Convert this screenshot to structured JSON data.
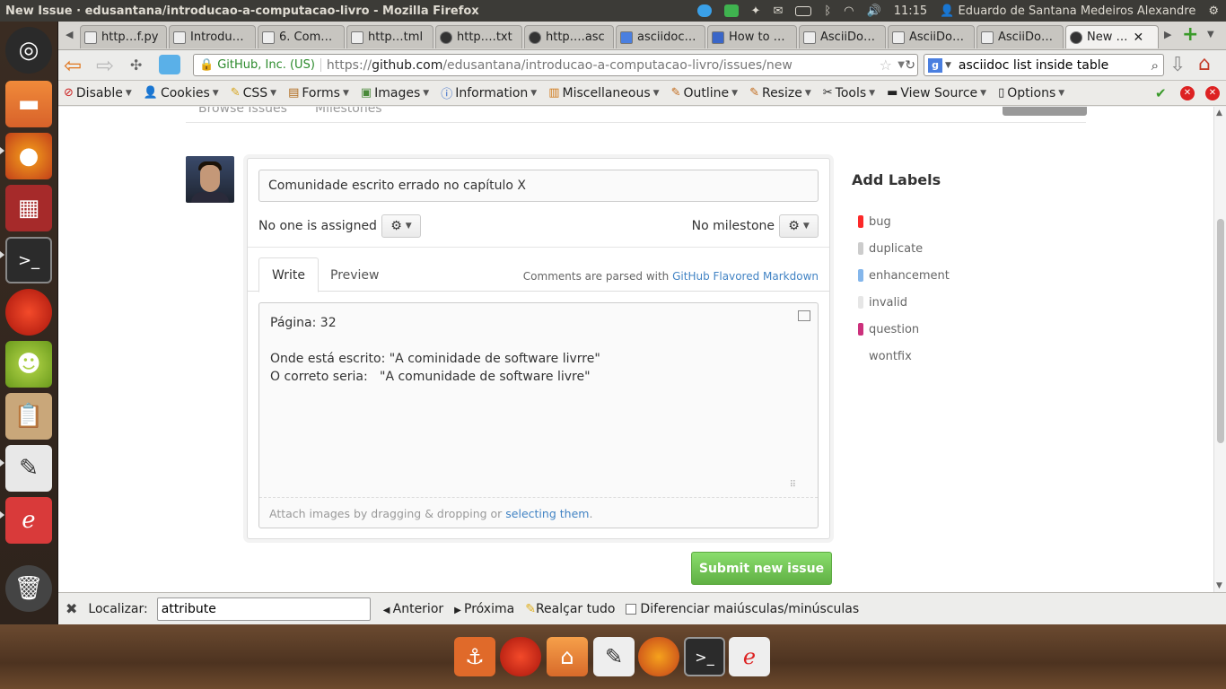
{
  "topbar": {
    "window_title": "New Issue · edusantana/introducao-a-computacao-livro - Mozilla Firefox",
    "time": "11:15",
    "user": "Eduardo de Santana Medeiros Alexandre"
  },
  "tabs": [
    {
      "label": "http…f.py"
    },
    {
      "label": "Introdu…"
    },
    {
      "label": "6. Com…"
    },
    {
      "label": "http…tml"
    },
    {
      "label": "http….txt"
    },
    {
      "label": "http….asc"
    },
    {
      "label": "asciidoc…"
    },
    {
      "label": "How to …"
    },
    {
      "label": "AsciiDo…"
    },
    {
      "label": "AsciiDo…"
    },
    {
      "label": "AsciiDo…"
    },
    {
      "label": "New …"
    }
  ],
  "navbar": {
    "identity": "GitHub, Inc. (US)",
    "url_prefix": "https://",
    "url_host": "github.com",
    "url_path": "/edusantana/introducao-a-computacao-livro/issues/new",
    "search_value": "asciidoc list inside table"
  },
  "devbar": {
    "items": [
      "Disable",
      "Cookies",
      "CSS",
      "Forms",
      "Images",
      "Information",
      "Miscellaneous",
      "Outline",
      "Resize",
      "Tools",
      "View Source",
      "Options"
    ]
  },
  "page": {
    "ghost_tab1": "Browse Issues",
    "ghost_tab2": "Milestones",
    "issue_title": "Comunidade escrito errado no capítulo X",
    "assignee_text": "No one is assigned",
    "milestone_text": "No milestone",
    "tab_write": "Write",
    "tab_preview": "Preview",
    "parsed_prefix": "Comments are parsed with ",
    "parsed_link": "GitHub Flavored Markdown",
    "body_line1": "Página: 32",
    "body_line2": "Onde está escrito: \"A cominidade de software livrre\"",
    "body_line3": "O correto seria:   \"A comunidade de software livre\"",
    "attach_prefix": "Attach images by dragging & dropping or ",
    "attach_link": "selecting them",
    "attach_suffix": ".",
    "submit_label": "Submit new issue",
    "labels_heading": "Add Labels",
    "labels": [
      {
        "name": "bug",
        "color": "#fc2929"
      },
      {
        "name": "duplicate",
        "color": "#cccccc"
      },
      {
        "name": "enhancement",
        "color": "#84b6eb"
      },
      {
        "name": "invalid",
        "color": "#e6e6e6"
      },
      {
        "name": "question",
        "color": "#cc317c"
      },
      {
        "name": "wontfix",
        "color": "#ffffff"
      }
    ]
  },
  "findbar": {
    "label": "Localizar:",
    "value": "attribute",
    "prev": "Anterior",
    "next": "Próxima",
    "highlight": "Realçar tudo",
    "match_case": "Diferenciar maiúsculas/minúsculas"
  }
}
